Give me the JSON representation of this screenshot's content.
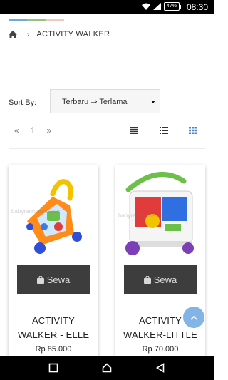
{
  "status_bar": {
    "time": "08:30",
    "battery": "47%"
  },
  "colors": {
    "strip": [
      "#6fa8dc",
      "#93c47d",
      "#f4c7c3"
    ],
    "sewa_button": "#3d3d3d",
    "fab": "#82b4e6",
    "active_view": "#4a86c5"
  },
  "breadcrumb": {
    "home_icon": "home-icon",
    "title": "ACTIVITY WALKER"
  },
  "sort": {
    "label": "Sort By:",
    "selected": "Terbaru ⇒ Terlama"
  },
  "pager": {
    "prev": "«",
    "page": "1",
    "next": "»"
  },
  "products": [
    {
      "action": "Sewa",
      "name_line1": "ACTIVITY",
      "name_line2": "WALKER - ELLE",
      "price": "Rp 85.000"
    },
    {
      "action": "Sewa",
      "name_line1": "ACTIVITY",
      "name_line2": "WALKER-LITTLE",
      "price": "Rp 70.000"
    }
  ]
}
